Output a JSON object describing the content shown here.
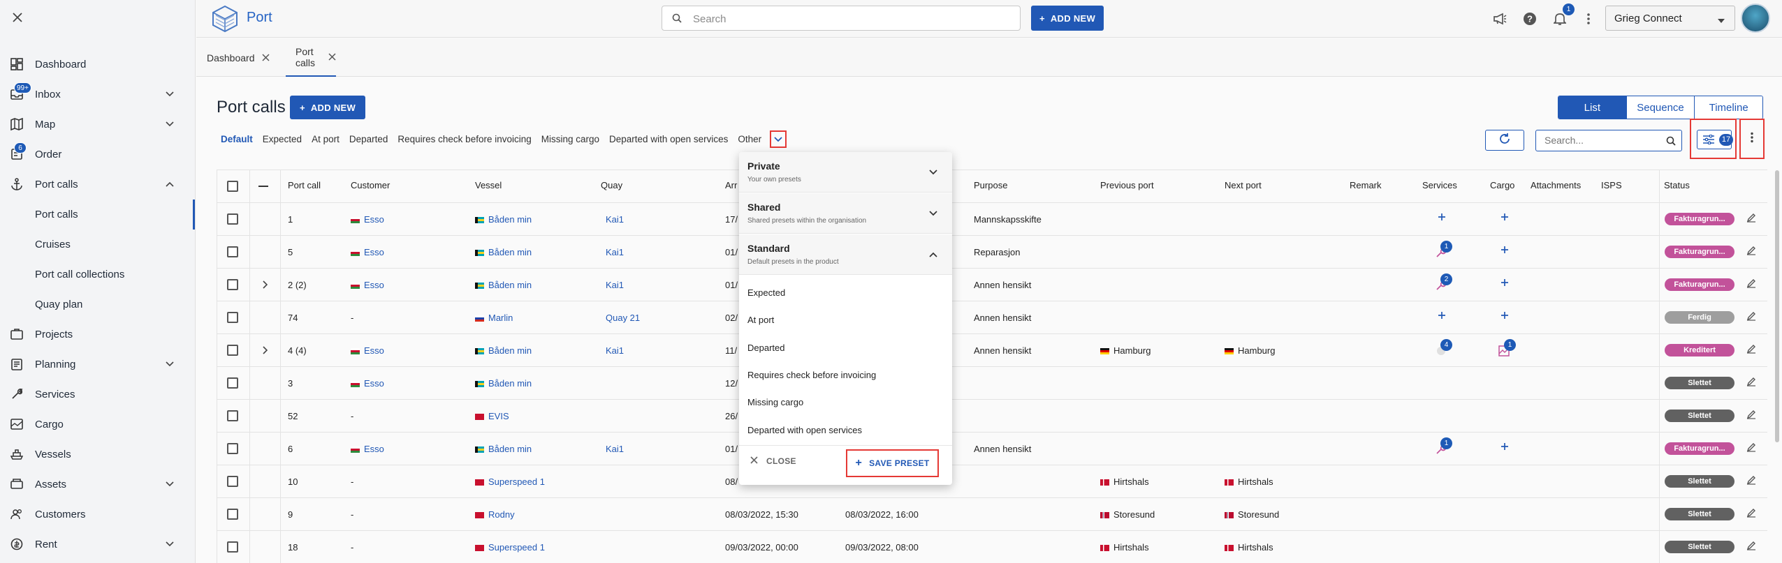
{
  "sidebar": {
    "items": [
      {
        "label": "Dashboard",
        "icon": "dashboard-icon"
      },
      {
        "label": "Inbox",
        "badge": "99+",
        "icon": "inbox-icon"
      },
      {
        "label": "Map",
        "icon": "map-icon"
      },
      {
        "label": "Order",
        "badge": "6",
        "icon": "order-icon"
      },
      {
        "label": "Port calls",
        "icon": "anchor-icon"
      },
      {
        "label": "Port calls"
      },
      {
        "label": "Cruises"
      },
      {
        "label": "Port call collections"
      },
      {
        "label": "Quay plan"
      },
      {
        "label": "Projects",
        "icon": "projects-icon"
      },
      {
        "label": "Planning",
        "icon": "planning-icon"
      },
      {
        "label": "Services",
        "icon": "services-icon"
      },
      {
        "label": "Cargo",
        "icon": "cargo-icon"
      },
      {
        "label": "Vessels",
        "icon": "vessels-icon"
      },
      {
        "label": "Assets",
        "icon": "assets-icon"
      },
      {
        "label": "Customers",
        "icon": "customers-icon"
      },
      {
        "label": "Rent",
        "icon": "rent-icon"
      }
    ]
  },
  "header": {
    "app_title": "Port",
    "search_placeholder": "Search",
    "add_new": "ADD NEW",
    "bell_count": "1",
    "company": "Grieg Connect"
  },
  "tabs": [
    {
      "label": "Dashboard"
    },
    {
      "label": "Port calls"
    }
  ],
  "main": {
    "title": "Port calls",
    "add_new": "ADD NEW",
    "views": [
      "List",
      "Sequence",
      "Timeline"
    ],
    "presets": [
      "Default",
      "Expected",
      "At port",
      "Departed",
      "Requires check before invoicing",
      "Missing cargo",
      "Departed with open services",
      "Other"
    ],
    "search_placeholder": "Search...",
    "filter_count": "17"
  },
  "table": {
    "columns": [
      "Port call",
      "Customer",
      "Vessel",
      "Quay",
      "Arr",
      "Purpose",
      "Previous port",
      "Next port",
      "Remark",
      "Services",
      "Cargo",
      "Attachments",
      "ISPS",
      "Status"
    ],
    "rows": [
      {
        "portcall": "1",
        "customer": "Esso",
        "vessel": "Båden min",
        "quay": "Kai1",
        "arr": "17/",
        "dep": "",
        "purpose": "Mannskapsskifte",
        "prev": "",
        "next": "",
        "status": "Fakturagrun...",
        "status_color": "#c2529a"
      },
      {
        "portcall": "5",
        "customer": "Esso",
        "vessel": "Båden min",
        "quay": "Kai1",
        "arr": "01/",
        "dep": "",
        "purpose": "Reparasjon",
        "prev": "",
        "next": "",
        "status": "Fakturagrun...",
        "status_color": "#c2529a"
      },
      {
        "portcall": "2 (2)",
        "customer": "Esso",
        "vessel": "Båden min",
        "quay": "Kai1",
        "arr": "01/",
        "dep": "",
        "purpose": "Annen hensikt",
        "prev": "",
        "next": "",
        "status": "Fakturagrun...",
        "status_color": "#c2529a"
      },
      {
        "portcall": "74",
        "customer": "-",
        "vessel": "Marlin",
        "quay": "Quay 21",
        "arr": "02/",
        "dep": "",
        "purpose": "Annen hensikt",
        "prev": "",
        "next": "",
        "status": "Ferdig",
        "status_color": "#9e9e9e"
      },
      {
        "portcall": "4 (4)",
        "customer": "Esso",
        "vessel": "Båden min",
        "quay": "Kai1",
        "arr": "11/",
        "dep": "",
        "purpose": "Annen hensikt",
        "prev": "Hamburg",
        "next": "Hamburg",
        "status": "Kreditert",
        "status_color": "#c2529a"
      },
      {
        "portcall": "3",
        "customer": "Esso",
        "vessel": "Båden min",
        "quay": "",
        "arr": "12/",
        "dep": "",
        "purpose": "",
        "prev": "",
        "next": "",
        "status": "Slettet",
        "status_color": "#616161"
      },
      {
        "portcall": "52",
        "customer": "-",
        "vessel": "EVIS",
        "quay": "",
        "arr": "26/",
        "dep": "",
        "purpose": "",
        "prev": "",
        "next": "",
        "status": "Slettet",
        "status_color": "#616161"
      },
      {
        "portcall": "6",
        "customer": "Esso",
        "vessel": "Båden min",
        "quay": "Kai1",
        "arr": "01/",
        "dep": "",
        "purpose": "Annen hensikt",
        "prev": "",
        "next": "",
        "status": "Fakturagrun...",
        "status_color": "#c2529a"
      },
      {
        "portcall": "10",
        "customer": "-",
        "vessel": "Superspeed 1",
        "quay": "",
        "arr": "08/",
        "dep": "",
        "purpose": "",
        "prev": "Hirtshals",
        "next": "Hirtshals",
        "status": "Slettet",
        "status_color": "#616161"
      },
      {
        "portcall": "9",
        "customer": "-",
        "vessel": "Rodny",
        "quay": "",
        "arr": "08/03/2022, 15:30",
        "dep": "08/03/2022, 16:00",
        "purpose": "",
        "prev": "Storesund",
        "next": "Storesund",
        "status": "Slettet",
        "status_color": "#616161"
      },
      {
        "portcall": "18",
        "customer": "-",
        "vessel": "Superspeed 1",
        "quay": "",
        "arr": "09/03/2022, 00:00",
        "dep": "09/03/2022, 08:00",
        "purpose": "",
        "prev": "Hirtshals",
        "next": "Hirtshals",
        "status": "Slettet",
        "status_color": "#616161"
      }
    ]
  },
  "dropdown": {
    "sections": [
      {
        "title": "Private",
        "subtitle": "Your own presets"
      },
      {
        "title": "Shared",
        "subtitle": "Shared presets within the organisation"
      },
      {
        "title": "Standard",
        "subtitle": "Default presets in the product"
      }
    ],
    "options": [
      "Expected",
      "At port",
      "Departed",
      "Requires check before invoicing",
      "Missing cargo",
      "Departed with open services"
    ],
    "close": "CLOSE",
    "save": "SAVE PRESET"
  },
  "colors": {
    "accent": "#2158b5",
    "highlight": "#e53935",
    "isps_green": "#3a9c4c"
  }
}
